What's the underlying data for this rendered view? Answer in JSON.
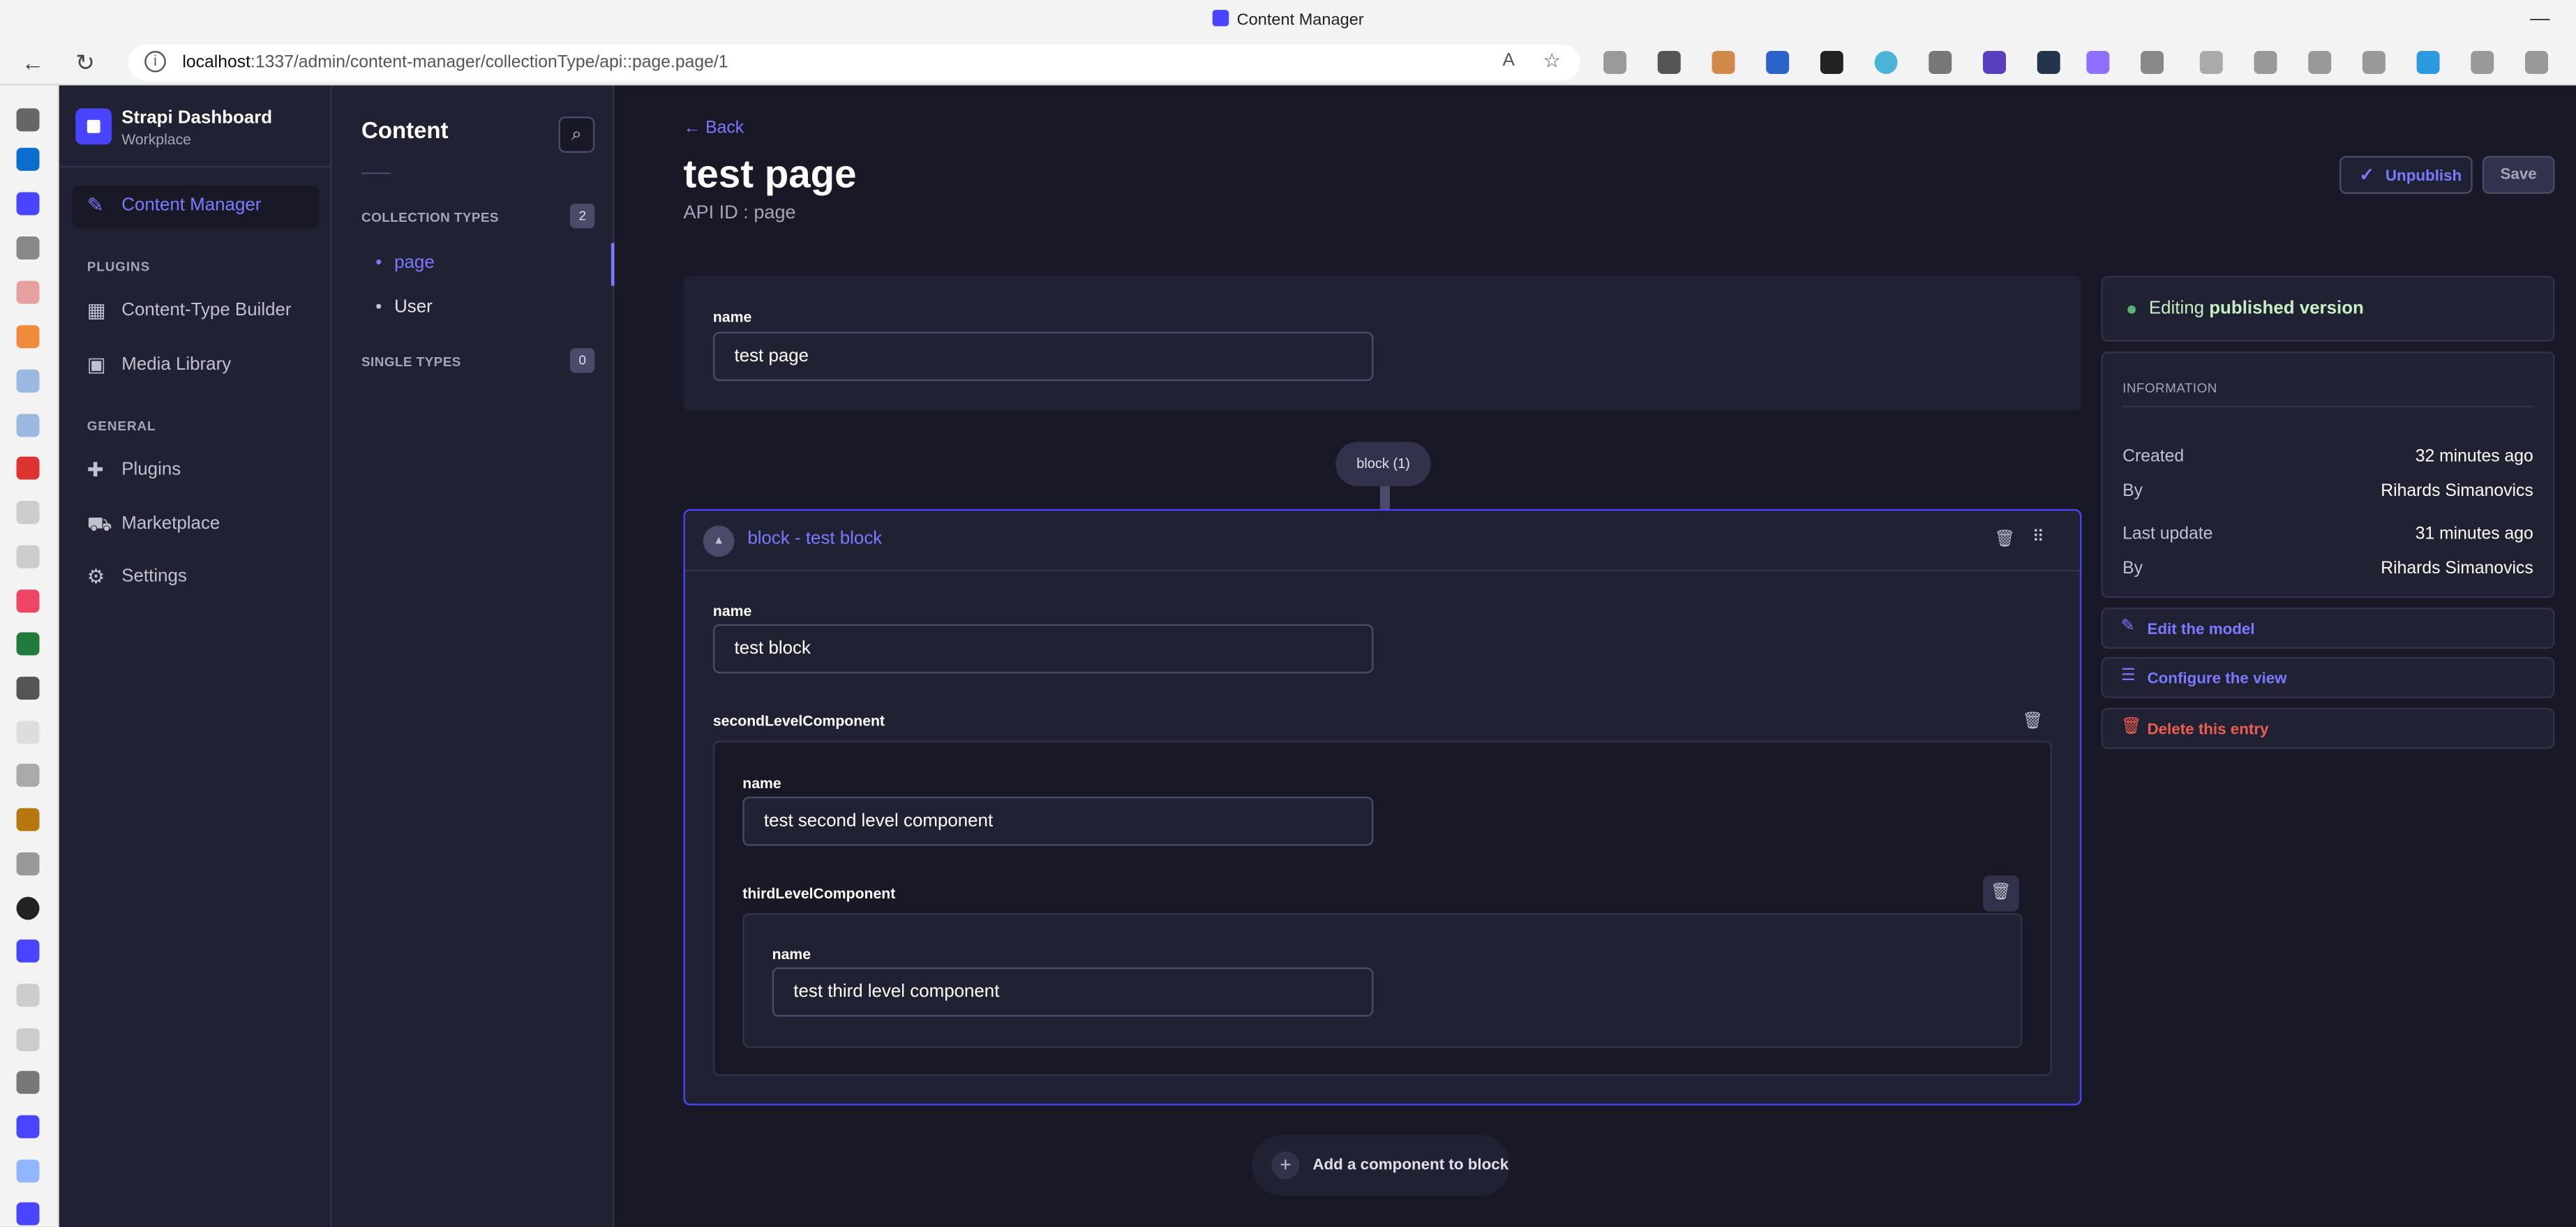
{
  "browser": {
    "title": "Content Manager",
    "url_host": "localhost",
    "url_path": ":1337/admin/content-manager/collectionType/api::page.page/1"
  },
  "brand": {
    "name": "Strapi Dashboard",
    "workspace": "Workplace",
    "color": "#4945ff"
  },
  "mainnav": {
    "content_manager": "Content Manager",
    "plugins_head": "PLUGINS",
    "ctb": "Content-Type Builder",
    "media": "Media Library",
    "general_head": "GENERAL",
    "plugins": "Plugins",
    "marketplace": "Marketplace",
    "settings": "Settings"
  },
  "subnav": {
    "title": "Content",
    "collection_head": "COLLECTION TYPES",
    "collection_count": "2",
    "items": [
      {
        "label": "page"
      },
      {
        "label": "User"
      }
    ],
    "single_head": "SINGLE TYPES",
    "single_count": "0"
  },
  "header": {
    "back": "Back",
    "title": "test page",
    "api_id": "API ID : page",
    "unpublish": "Unpublish",
    "save": "Save"
  },
  "form": {
    "name_label": "name",
    "name_value": "test page",
    "block_pill": "block (1)",
    "block_title": "block - test block",
    "block_name_label": "name",
    "block_name_value": "test block",
    "second_label": "secondLevelComponent",
    "second_name_label": "name",
    "second_name_value": "test second level component",
    "third_label": "thirdLevelComponent",
    "third_name_label": "name",
    "third_name_value": "test third level component",
    "add_component": "Add a component to block"
  },
  "sidebar": {
    "status_prefix": "Editing ",
    "status_bold": "published version",
    "info_head": "INFORMATION",
    "created_k": "Created",
    "created_v": "32 minutes ago",
    "by1_k": "By",
    "by1_v": "Rihards Simanovics",
    "updated_k": "Last update",
    "updated_v": "31 minutes ago",
    "by2_k": "By",
    "by2_v": "Rihards Simanovics",
    "edit_model": "Edit the model",
    "configure_view": "Configure the view",
    "delete_entry": "Delete this entry"
  }
}
